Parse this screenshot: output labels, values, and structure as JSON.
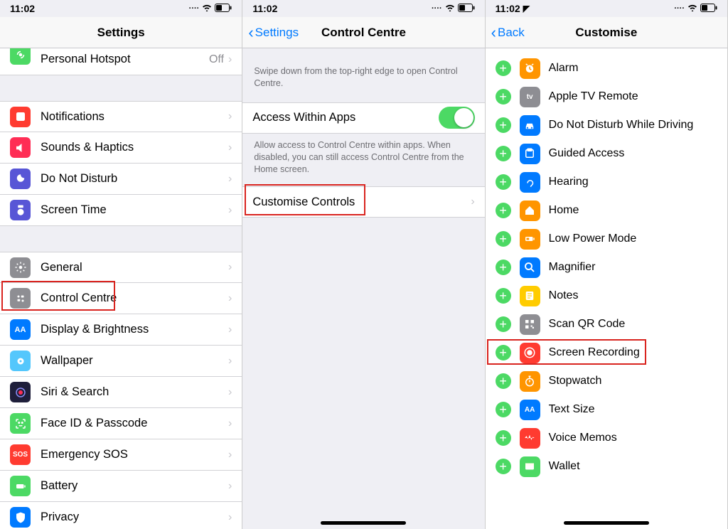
{
  "status": {
    "time": "11:02",
    "loc_glyph": "➤"
  },
  "pane1": {
    "title": "Settings",
    "first_row": {
      "label": "Personal Hotspot",
      "detail": "Off"
    },
    "group2": [
      {
        "name": "notifications",
        "label": "Notifications",
        "color": "#ff3b30"
      },
      {
        "name": "sounds",
        "label": "Sounds & Haptics",
        "color": "#ff2d55"
      },
      {
        "name": "dnd",
        "label": "Do Not Disturb",
        "color": "#5856d6"
      },
      {
        "name": "screentime",
        "label": "Screen Time",
        "color": "#5856d6"
      }
    ],
    "group3": [
      {
        "name": "general",
        "label": "General",
        "color": "#8e8e93"
      },
      {
        "name": "controlcentre",
        "label": "Control Centre",
        "color": "#8e8e93",
        "hl": true
      },
      {
        "name": "display",
        "label": "Display & Brightness",
        "color": "#007aff"
      },
      {
        "name": "wallpaper",
        "label": "Wallpaper",
        "color": "#54c7fc"
      },
      {
        "name": "siri",
        "label": "Siri & Search",
        "color": "#1f1f3b"
      },
      {
        "name": "faceid",
        "label": "Face ID & Passcode",
        "color": "#4cd964"
      },
      {
        "name": "sos",
        "label": "Emergency SOS",
        "color": "#ff3b30",
        "text": "SOS"
      },
      {
        "name": "battery",
        "label": "Battery",
        "color": "#4cd964"
      },
      {
        "name": "privacy",
        "label": "Privacy",
        "color": "#007aff"
      }
    ]
  },
  "pane2": {
    "back": "Settings",
    "title": "Control Centre",
    "desc1": "Swipe down from the top-right edge to open Control Centre.",
    "row_access": "Access Within Apps",
    "desc2": "Allow access to Control Centre within apps. When disabled, you can still access Control Centre from the Home screen.",
    "row_customise": "Customise Controls"
  },
  "pane3": {
    "back": "Back",
    "title": "Customise",
    "items": [
      {
        "name": "alarm",
        "label": "Alarm",
        "color": "#ff9500"
      },
      {
        "name": "appletv",
        "label": "Apple TV Remote",
        "color": "#8e8e93",
        "text": "tv"
      },
      {
        "name": "dnddriving",
        "label": "Do Not Disturb While Driving",
        "color": "#007aff"
      },
      {
        "name": "guided",
        "label": "Guided Access",
        "color": "#007aff"
      },
      {
        "name": "hearing",
        "label": "Hearing",
        "color": "#007aff"
      },
      {
        "name": "home",
        "label": "Home",
        "color": "#ff9500"
      },
      {
        "name": "lowpower",
        "label": "Low Power Mode",
        "color": "#ff9500"
      },
      {
        "name": "magnifier",
        "label": "Magnifier",
        "color": "#007aff"
      },
      {
        "name": "notes",
        "label": "Notes",
        "color": "#ffcc00"
      },
      {
        "name": "qr",
        "label": "Scan QR Code",
        "color": "#8e8e93"
      },
      {
        "name": "screenrec",
        "label": "Screen Recording",
        "color": "#ff3b30",
        "hl": true
      },
      {
        "name": "stopwatch",
        "label": "Stopwatch",
        "color": "#ff9500"
      },
      {
        "name": "textsize",
        "label": "Text Size",
        "color": "#007aff",
        "text": "AA"
      },
      {
        "name": "voicememos",
        "label": "Voice Memos",
        "color": "#ff3b30"
      },
      {
        "name": "wallet",
        "label": "Wallet",
        "color": "#4cd964"
      }
    ]
  }
}
